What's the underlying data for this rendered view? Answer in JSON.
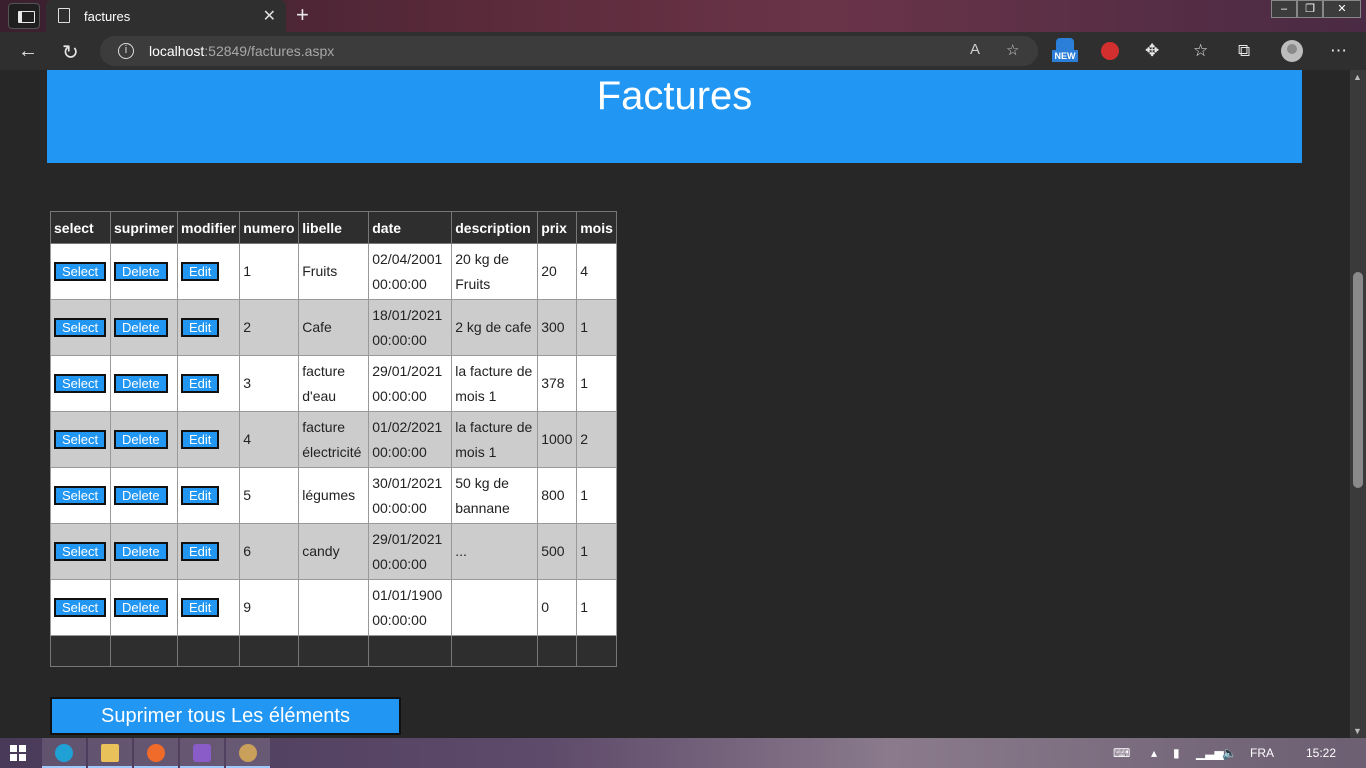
{
  "browser": {
    "tab_title": "factures",
    "url_host": "localhost",
    "url_rest": ":52849/factures.aspx",
    "new_badge": "NEW"
  },
  "page": {
    "title": "Factures",
    "columns": [
      "select",
      "suprimer",
      "modifier",
      "numero",
      "libelle",
      "date",
      "description",
      "prix",
      "mois"
    ],
    "buttons": {
      "select": "Select",
      "delete": "Delete",
      "edit": "Edit"
    },
    "rows": [
      {
        "numero": "1",
        "libelle": "Fruits",
        "date_line1": "02/04/2001",
        "date_line2": "00:00:00",
        "desc_line1": "20 kg de",
        "desc_line2": "Fruits",
        "prix": "20",
        "mois": "4"
      },
      {
        "numero": "2",
        "libelle": "Cafe",
        "date_line1": "18/01/2021",
        "date_line2": "00:00:00",
        "desc_line1": "2 kg de cafe",
        "desc_line2": "",
        "prix": "300",
        "mois": "1"
      },
      {
        "numero": "3",
        "libelle": "facture d'eau",
        "date_line1": "29/01/2021",
        "date_line2": "00:00:00",
        "desc_line1": "la facture de",
        "desc_line2": "mois 1",
        "prix": "378",
        "mois": "1"
      },
      {
        "numero": "4",
        "libelle": "facture électricité",
        "date_line1": "01/02/2021",
        "date_line2": "00:00:00",
        "desc_line1": "la facture de",
        "desc_line2": "mois 1",
        "prix": "1000",
        "mois": "2"
      },
      {
        "numero": "5",
        "libelle": "légumes",
        "date_line1": "30/01/2021",
        "date_line2": "00:00:00",
        "desc_line1": "50 kg de",
        "desc_line2": "bannane",
        "prix": "800",
        "mois": "1"
      },
      {
        "numero": "6",
        "libelle": "candy",
        "date_line1": "29/01/2021",
        "date_line2": "00:00:00",
        "desc_line1": "...",
        "desc_line2": "",
        "prix": "500",
        "mois": "1"
      },
      {
        "numero": "9",
        "libelle": "",
        "date_line1": "01/01/1900",
        "date_line2": "00:00:00",
        "desc_line1": "",
        "desc_line2": "",
        "prix": "0",
        "mois": "1"
      }
    ],
    "delete_all_label": "Suprimer tous Les éléments"
  },
  "taskbar": {
    "language": "FRA",
    "time": "15:22"
  },
  "colors": {
    "accent": "#2196f3",
    "page_bg": "#272727",
    "row_alt": "#cccccc"
  }
}
